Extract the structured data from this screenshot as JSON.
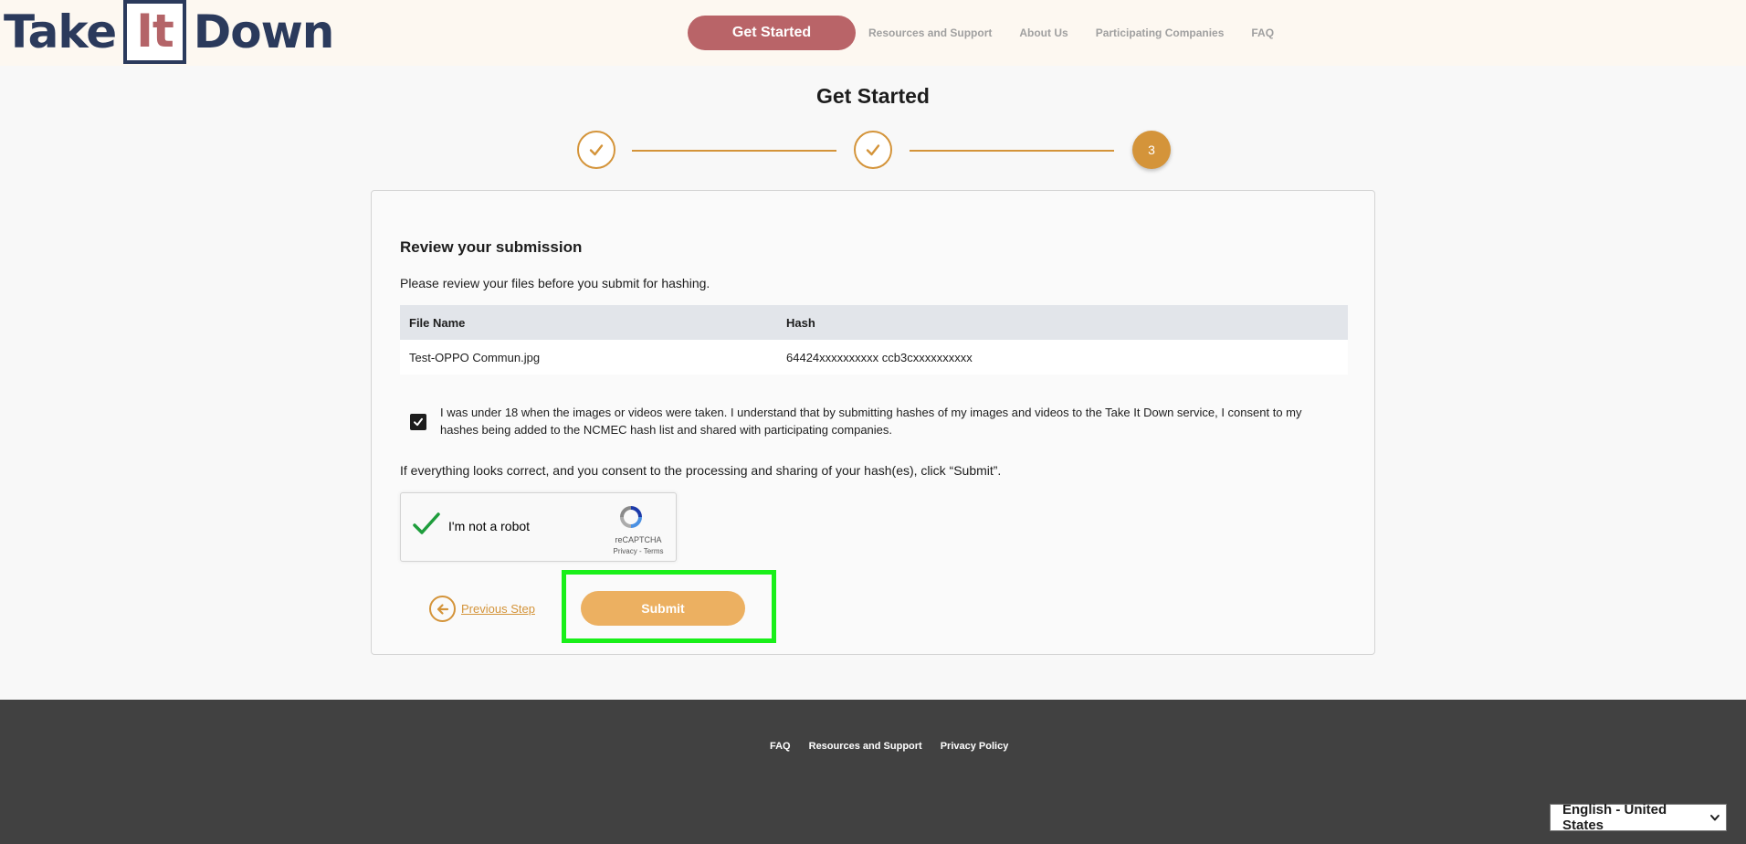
{
  "header": {
    "logo": {
      "part1": "Take",
      "part2": "It",
      "part3": "Down"
    },
    "nav": {
      "cta": "Get Started",
      "links": [
        "Resources and Support",
        "About Us",
        "Participating Companies",
        "FAQ"
      ]
    }
  },
  "page": {
    "title": "Get Started",
    "stepper": {
      "current_step": "3",
      "total_steps": 3,
      "completed_steps": 2
    }
  },
  "review": {
    "heading": "Review your submission",
    "description": "Please review your files before you submit for hashing.",
    "table": {
      "headers": [
        "File Name",
        "Hash"
      ],
      "rows": [
        [
          "Test-OPPO Commun.jpg",
          "64424xxxxxxxxxx ccb3cxxxxxxxxxx"
        ]
      ]
    },
    "consent": {
      "checked": true,
      "text": "I was under 18 when the images or videos were taken. I understand that by submitting hashes of my images and videos to the Take It Down service, I consent to my hashes being added to the NCMEC hash list and shared with participating companies."
    },
    "instruction": "If everything looks correct, and you consent to the processing and sharing of your hash(es), click “Submit”.",
    "captcha": {
      "label": "I'm not a robot",
      "brand": "reCAPTCHA",
      "links": "Privacy - Terms"
    },
    "prev_label": "Previous Step",
    "submit_label": "Submit"
  },
  "footer": {
    "links": [
      "FAQ",
      "Resources and Support",
      "Privacy Policy"
    ],
    "language": "English - United States"
  },
  "colors": {
    "brand_navy": "#2b3a5c",
    "brand_rose": "#b96468",
    "accent_gold": "#d4943a",
    "submit_gold": "#ecb061",
    "highlight_green": "#19ef19",
    "footer_bg": "#414141"
  }
}
